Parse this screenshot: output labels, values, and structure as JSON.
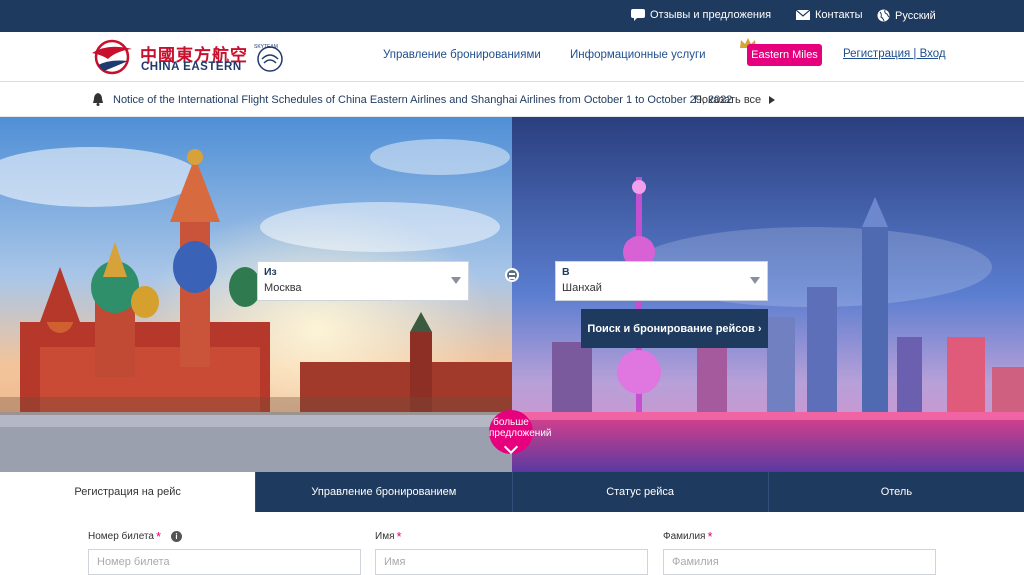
{
  "topbar": {
    "feedback": "Отзывы и предложения",
    "contacts": "Контакты",
    "language": "Русский",
    "icons": [
      "chat-icon",
      "envelope-icon",
      "globe-icon"
    ]
  },
  "header": {
    "logo_cn": "中國東方航空",
    "logo_en": "CHINA EASTERN",
    "logo_alliance": "SKYTEAM",
    "nav": [
      "Управление бронированиями",
      "Информационные услуги"
    ],
    "miles": "Eastern Miles",
    "auth": "Регистрация | Вход"
  },
  "notice": {
    "text": "Notice of the International Flight Schedules of China Eastern Airlines and Shanghai Airlines from October 1 to October 29, 2022",
    "show_all": "Показать все"
  },
  "search": {
    "from_label": "Из",
    "from_value": "Москва",
    "to_label": "В",
    "to_value": "Шанхай",
    "button": "Поиск и бронирование рейсов",
    "more": "больше предложений"
  },
  "tabs": [
    {
      "label": "Регистрация на рейс",
      "active": true
    },
    {
      "label": "Управление бронированием",
      "active": false
    },
    {
      "label": "Статус рейса",
      "active": false
    },
    {
      "label": "Отель",
      "active": false
    }
  ],
  "form": {
    "ticket_label": "Номер билета",
    "ticket_placeholder": "Номер билета",
    "first_label": "Имя",
    "first_placeholder": "Имя",
    "last_label": "Фамилия",
    "last_placeholder": "Фамилия"
  },
  "colors": {
    "navy": "#1f3a5f",
    "brand_red": "#c8102e",
    "brand_pink": "#e6007e"
  }
}
